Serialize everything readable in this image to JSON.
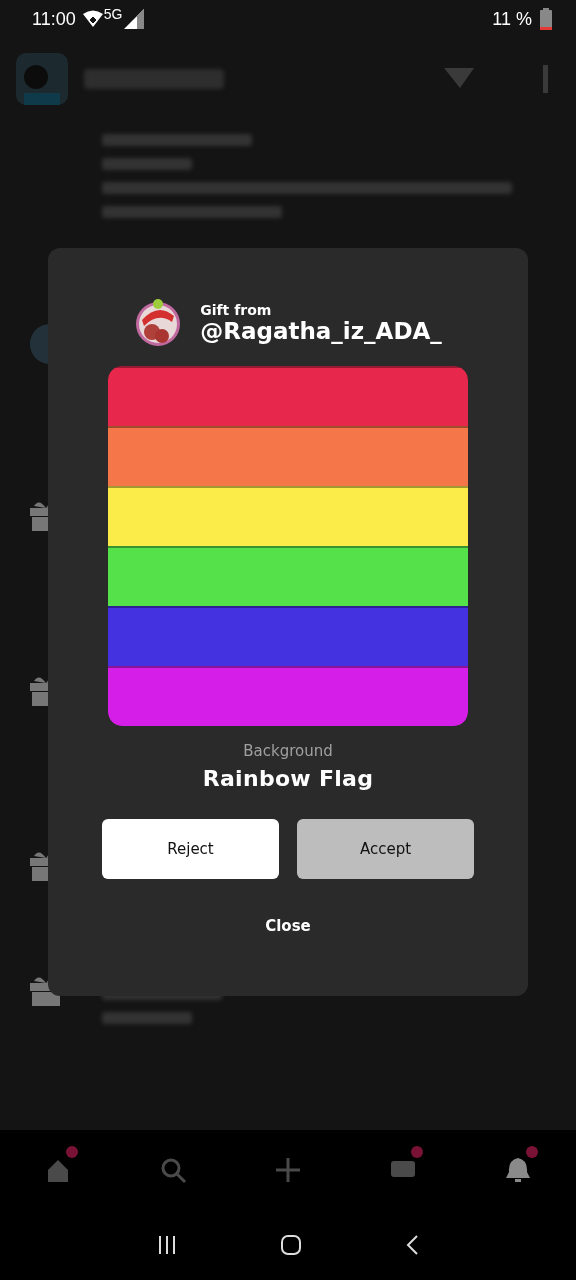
{
  "status_bar": {
    "time": "11:00",
    "network": "5G",
    "battery": "11 %"
  },
  "notifications": [
    {
      "kind": "text"
    },
    {
      "kind": "avatar"
    },
    {
      "kind": "gift"
    },
    {
      "kind": "gift"
    },
    {
      "kind": "gift"
    },
    {
      "kind": "gift"
    }
  ],
  "dialog": {
    "caption": "Gift from",
    "sender": "@Ragatha_iz_ADA_",
    "item_type": "Background",
    "item_name": "Rainbow Flag",
    "buttons": [
      {
        "label": "Reject",
        "kind": "secondary"
      },
      {
        "label": "Accept",
        "kind": "primary"
      }
    ],
    "close": "Close"
  },
  "bottom_nav": [
    {
      "kind": "home",
      "badge": true,
      "selected": false
    },
    {
      "kind": "search",
      "badge": false,
      "selected": false
    },
    {
      "kind": "post",
      "badge": false,
      "selected": false
    },
    {
      "kind": "chat",
      "badge": true,
      "selected": false
    },
    {
      "kind": "bell",
      "badge": true,
      "selected": true
    }
  ]
}
